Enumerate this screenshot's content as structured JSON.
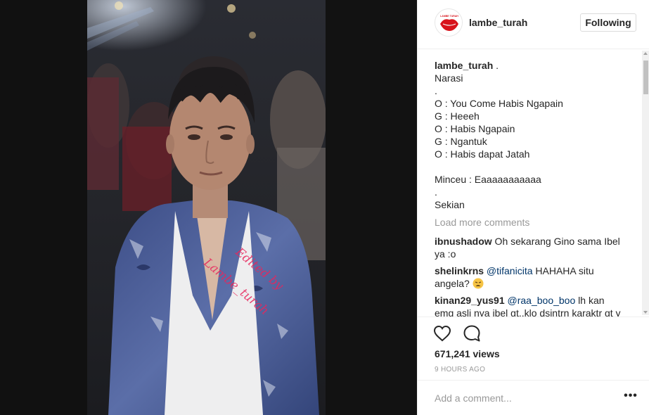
{
  "post": {
    "username": "lambe_turah",
    "follow_label": "Following",
    "avatar_text": "LAMBE TURAH"
  },
  "video": {
    "watermark_line1": "Edited by",
    "watermark_line2": "Lambe_turah"
  },
  "caption": {
    "author": "lambe_turah",
    "author_suffix": " .",
    "lines": [
      "Narasi",
      ".",
      "O : You Come Habis Ngapain",
      "G : Heeeh",
      "O : Habis Ngapain",
      "G : Ngantuk",
      "O : Habis dapat Jatah",
      "",
      "Minceu : Eaaaaaaaaaaa",
      ".",
      "Sekian"
    ]
  },
  "load_more_label": "Load more comments",
  "comments": [
    {
      "user": "ibnushadow",
      "mention": "",
      "text": " Oh sekarang Gino sama Ibel ya :o",
      "emoji": ""
    },
    {
      "user": "shelinkrns",
      "mention": "@tifanicita",
      "text": " HAHAHA situ angela? ",
      "emoji": "weary-face"
    },
    {
      "user": "kinan29_yus91",
      "mention": "@raa_boo_boo",
      "text": " lh kan emg asli nya ibel gt..klo dsintrn karaktr gt y cm",
      "emoji": ""
    }
  ],
  "stats": {
    "views": "671,241 views",
    "time": "9 HOURS AGO"
  },
  "add_comment": {
    "placeholder": "Add a comment...",
    "more_label": "•••"
  },
  "colors": {
    "mention": "#003569",
    "muted": "#999999",
    "text": "#262626",
    "border": "#efefef"
  },
  "icons": [
    "heart-icon",
    "comment-icon",
    "more-options-icon",
    "scroll-up-icon",
    "scroll-down-icon"
  ]
}
